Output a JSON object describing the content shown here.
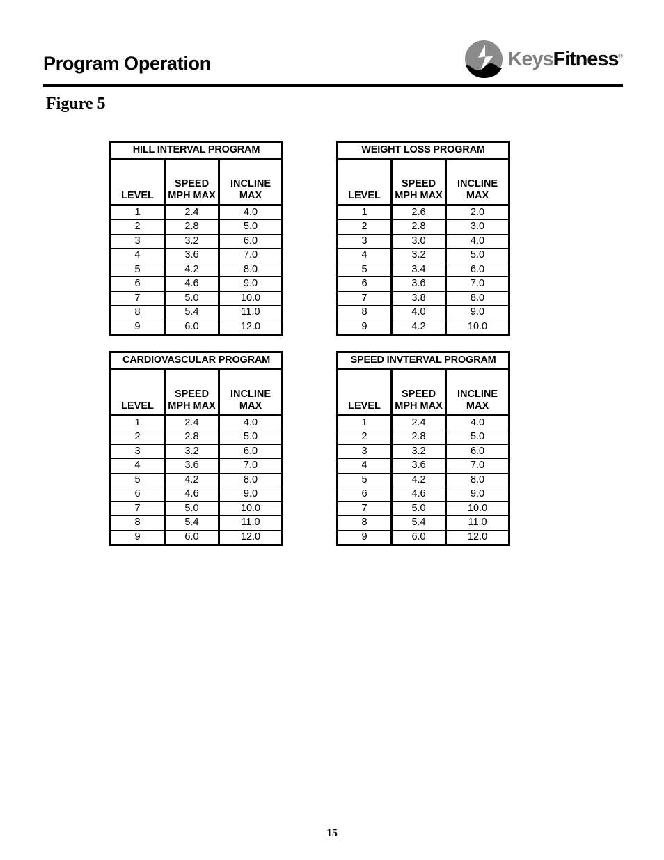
{
  "header": {
    "title": "Program Operation",
    "logo": {
      "icon_name": "keysfitness-logo-mark",
      "word_primary": "Keys",
      "word_secondary": "Fitness",
      "trademark": "®",
      "color_primary": "#808080",
      "color_secondary": "#0a0a0a"
    }
  },
  "figure": {
    "caption": "Figure 5"
  },
  "tables": [
    {
      "title": "HILL INTERVAL PROGRAM",
      "columns": [
        {
          "line1": "",
          "line2": "LEVEL"
        },
        {
          "line1": "SPEED",
          "line2": "MPH MAX"
        },
        {
          "line1": "INCLINE",
          "line2": "MAX"
        }
      ],
      "rows": [
        [
          "1",
          "2.4",
          "4.0"
        ],
        [
          "2",
          "2.8",
          "5.0"
        ],
        [
          "3",
          "3.2",
          "6.0"
        ],
        [
          "4",
          "3.6",
          "7.0"
        ],
        [
          "5",
          "4.2",
          "8.0"
        ],
        [
          "6",
          "4.6",
          "9.0"
        ],
        [
          "7",
          "5.0",
          "10.0"
        ],
        [
          "8",
          "5.4",
          "11.0"
        ],
        [
          "9",
          "6.0",
          "12.0"
        ]
      ]
    },
    {
      "title": "WEIGHT LOSS PROGRAM",
      "columns": [
        {
          "line1": "",
          "line2": "LEVEL"
        },
        {
          "line1": "SPEED",
          "line2": "MPH MAX"
        },
        {
          "line1": "INCLINE",
          "line2": "MAX"
        }
      ],
      "rows": [
        [
          "1",
          "2.6",
          "2.0"
        ],
        [
          "2",
          "2.8",
          "3.0"
        ],
        [
          "3",
          "3.0",
          "4.0"
        ],
        [
          "4",
          "3.2",
          "5.0"
        ],
        [
          "5",
          "3.4",
          "6.0"
        ],
        [
          "6",
          "3.6",
          "7.0"
        ],
        [
          "7",
          "3.8",
          "8.0"
        ],
        [
          "8",
          "4.0",
          "9.0"
        ],
        [
          "9",
          "4.2",
          "10.0"
        ]
      ]
    },
    {
      "title": "CARDIOVASCULAR PROGRAM",
      "columns": [
        {
          "line1": "",
          "line2": "LEVEL"
        },
        {
          "line1": "SPEED",
          "line2": "MPH MAX"
        },
        {
          "line1": "INCLINE",
          "line2": "MAX"
        }
      ],
      "rows": [
        [
          "1",
          "2.4",
          "4.0"
        ],
        [
          "2",
          "2.8",
          "5.0"
        ],
        [
          "3",
          "3.2",
          "6.0"
        ],
        [
          "4",
          "3.6",
          "7.0"
        ],
        [
          "5",
          "4.2",
          "8.0"
        ],
        [
          "6",
          "4.6",
          "9.0"
        ],
        [
          "7",
          "5.0",
          "10.0"
        ],
        [
          "8",
          "5.4",
          "11.0"
        ],
        [
          "9",
          "6.0",
          "12.0"
        ]
      ]
    },
    {
      "title": "SPEED INVTERVAL PROGRAM",
      "columns": [
        {
          "line1": "",
          "line2": "LEVEL"
        },
        {
          "line1": "SPEED",
          "line2": "MPH MAX"
        },
        {
          "line1": "INCLINE",
          "line2": "MAX"
        }
      ],
      "rows": [
        [
          "1",
          "2.4",
          "4.0"
        ],
        [
          "2",
          "2.8",
          "5.0"
        ],
        [
          "3",
          "3.2",
          "6.0"
        ],
        [
          "4",
          "3.6",
          "7.0"
        ],
        [
          "5",
          "4.2",
          "8.0"
        ],
        [
          "6",
          "4.6",
          "9.0"
        ],
        [
          "7",
          "5.0",
          "10.0"
        ],
        [
          "8",
          "5.4",
          "11.0"
        ],
        [
          "9",
          "6.0",
          "12.0"
        ]
      ]
    }
  ],
  "footer": {
    "page_number": "15"
  }
}
